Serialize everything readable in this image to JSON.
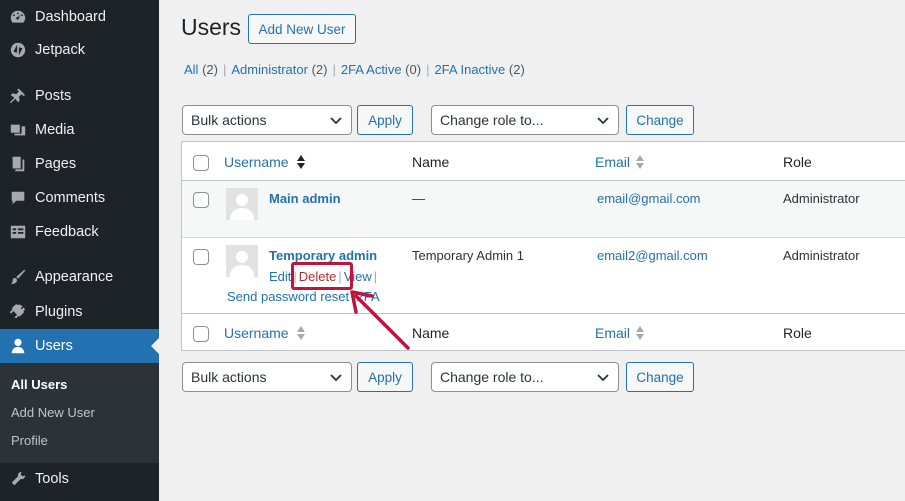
{
  "sidebar": {
    "items": [
      {
        "label": "Dashboard",
        "icon": "dashboard-icon"
      },
      {
        "label": "Jetpack",
        "icon": "jetpack-icon"
      },
      {
        "label": "Posts",
        "icon": "pin-icon"
      },
      {
        "label": "Media",
        "icon": "media-icon"
      },
      {
        "label": "Pages",
        "icon": "pages-icon"
      },
      {
        "label": "Comments",
        "icon": "comment-icon"
      },
      {
        "label": "Feedback",
        "icon": "feedback-icon"
      },
      {
        "label": "Appearance",
        "icon": "brush-icon"
      },
      {
        "label": "Plugins",
        "icon": "plug-icon"
      },
      {
        "label": "Users",
        "icon": "user-icon"
      },
      {
        "label": "Tools",
        "icon": "wrench-icon"
      }
    ],
    "submenu": [
      "All Users",
      "Add New User",
      "Profile"
    ]
  },
  "page": {
    "title": "Users",
    "add_new_label": "Add New User"
  },
  "filters": [
    {
      "label": "All",
      "count": "(2)"
    },
    {
      "label": "Administrator",
      "count": "(2)"
    },
    {
      "label": "2FA Active",
      "count": "(0)"
    },
    {
      "label": "2FA Inactive",
      "count": "(2)"
    }
  ],
  "toolbar": {
    "bulk_actions": "Bulk actions",
    "apply": "Apply",
    "change_role": "Change role to...",
    "change": "Change"
  },
  "table": {
    "headers": {
      "username": "Username",
      "name": "Name",
      "email": "Email",
      "role": "Role"
    },
    "rows": [
      {
        "username": "Main admin",
        "name": "—",
        "email": "email@gmail.com",
        "role": "Administrator"
      },
      {
        "username": "Temporary admin",
        "name": "Temporary Admin 1",
        "email": "email2@gmail.com",
        "role": "Administrator"
      }
    ],
    "row_actions": {
      "edit": "Edit",
      "delete": "Delete",
      "view": "View",
      "reset": "Send password reset",
      "twofa": "2FA"
    }
  },
  "colors": {
    "accent": "#2271b1",
    "sidebar": "#1d2327",
    "highlight": "#c0143c",
    "delete": "#b32d2e"
  }
}
